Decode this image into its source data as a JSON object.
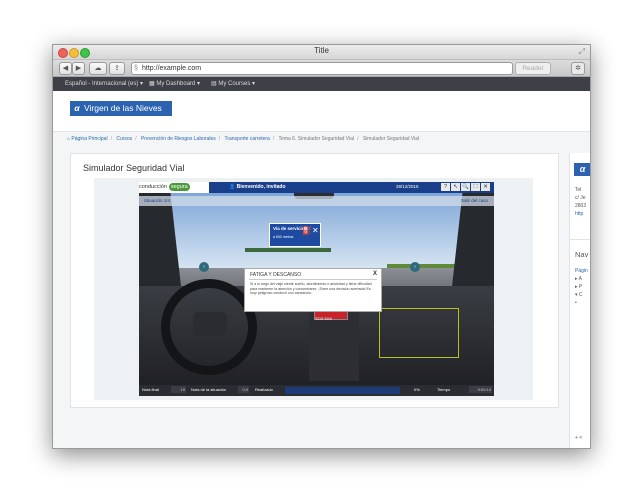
{
  "window": {
    "title": "Title"
  },
  "toolbar": {
    "url": "http://example.com",
    "reader": "Reader"
  },
  "navbar": {
    "items": [
      "Español - Internacional (es)",
      "My Dashboard",
      "My Courses"
    ]
  },
  "header": {
    "logo_text": "Virgen de las Nieves"
  },
  "breadcrumb": [
    "Página Principal",
    "Cursos",
    "Prevención de Riesgos Laborales",
    "Transporte carretera",
    "Tema 6. Simulador Seguridad Vial",
    "Simulador Seguridad Vial"
  ],
  "panel": {
    "title": "Simulador Seguridad Vial"
  },
  "sim": {
    "brand_left": "conducción",
    "brand_right": "segura",
    "welcome": "Bienvenido, invitado",
    "date": "28/12/2015",
    "toolbar_icons": [
      "?",
      "↖",
      "🔍",
      "⛶",
      "✕"
    ],
    "situation": "Situación 1/4",
    "exit": "Salir del caso",
    "sign": {
      "title": "Vía de servicio",
      "subtitle": "a 600 metros"
    },
    "modal": {
      "title": "FATIGA Y DESCANSO",
      "close": "X",
      "body": "Si a lo largo del viaje siente sueño, aturdimiento o ansiedad y tiene dificultad para mantener la atención y concentrarse. ¡Tome una decisión acertada! Es muy peligroso conducir con cansancio."
    },
    "radio_display": "SOS 5X8",
    "bottom": {
      "nota_final_label": "Nota final",
      "nota_final_value": "10",
      "nota_situacion_label": "Nota de la situación",
      "nota_situacion_value": "0.0",
      "realizado_label": "Realizado",
      "progress_pct": 0,
      "progress_label": "0%",
      "tiempo_label": "Tiempo",
      "tiempo_value": "0:00:14"
    }
  },
  "right_sidebar": {
    "lines": [
      "Tel",
      "c/ Je",
      "2803",
      "http"
    ],
    "nav_heading": "Nav",
    "nav_items": [
      "Págin",
      "▸ A",
      "▸ P",
      "▾ C",
      "  •"
    ],
    "bottom_icon": "+ <"
  }
}
